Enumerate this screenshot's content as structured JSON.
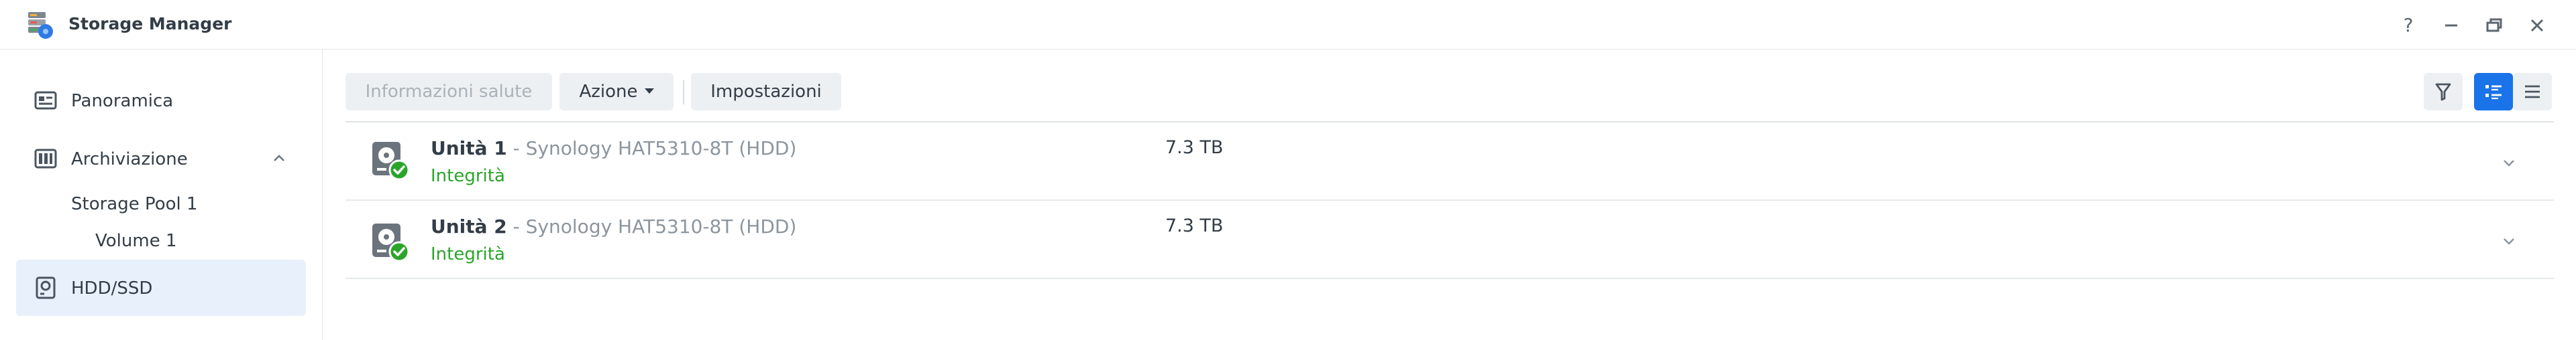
{
  "window": {
    "title": "Storage Manager",
    "icons": [
      "storage-manager-app-icon",
      "help-icon",
      "minimize-icon",
      "restore-icon",
      "close-icon"
    ],
    "help_label": "?"
  },
  "sidebar": {
    "items": [
      {
        "label": "Panoramica",
        "icon": "overview-icon",
        "active": false
      },
      {
        "label": "Archiviazione",
        "icon": "storage-icon",
        "active": false,
        "expanded": true
      },
      {
        "label": "HDD/SSD",
        "icon": "hdd-icon",
        "active": true
      }
    ],
    "subitems": [
      {
        "label": "Storage Pool 1"
      },
      {
        "label": "Volume 1"
      }
    ]
  },
  "toolbar": {
    "health_info_label": "Informazioni salute",
    "health_info_disabled": true,
    "action_label": "Azione",
    "settings_label": "Impostazioni",
    "view_icons": [
      "filter-icon",
      "detail-view-icon",
      "list-view-icon"
    ],
    "active_view": "detail-view-icon"
  },
  "disks": [
    {
      "name": "Unità 1",
      "model": " - Synology HAT5310-8T (HDD)",
      "status": "Integrità",
      "size": "7.3 TB"
    },
    {
      "name": "Unità 2",
      "model": " - Synology HAT5310-8T (HDD)",
      "status": "Integrità",
      "size": "7.3 TB"
    }
  ],
  "colors": {
    "accent": "#1a73e8",
    "healthy": "#2aa52a",
    "active_nav_bg": "#e8f0fb"
  }
}
